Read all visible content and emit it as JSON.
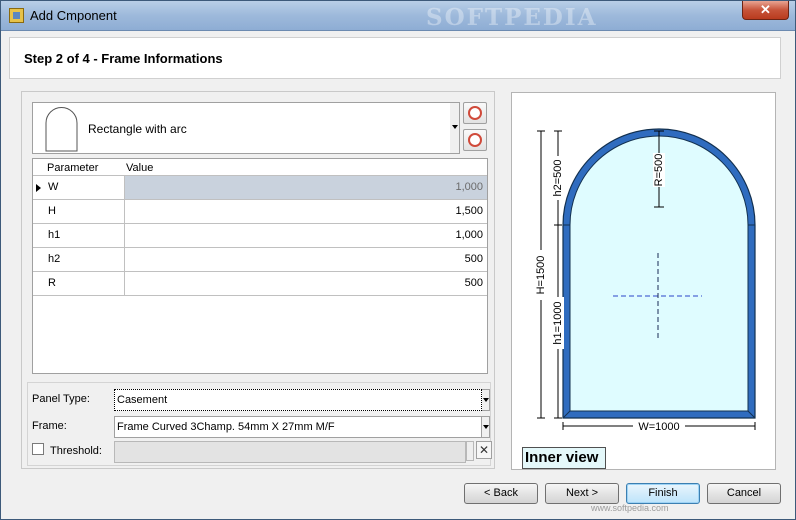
{
  "window": {
    "title": "Add Cmponent",
    "watermark": "SOFTPEDIA",
    "close_label": "✕"
  },
  "header": {
    "title": "Step 2 of 4 - Frame Informations"
  },
  "shape": {
    "selected": "Rectangle with arc",
    "icon": "arc-rectangle-icon"
  },
  "grid": {
    "columns": [
      "Parameter",
      "Value"
    ],
    "rows": [
      {
        "param": "W",
        "value": "1,000"
      },
      {
        "param": "H",
        "value": "1,500"
      },
      {
        "param": "h1",
        "value": "1,000"
      },
      {
        "param": "h2",
        "value": "500"
      },
      {
        "param": "R",
        "value": "500"
      }
    ]
  },
  "props": {
    "panel_type_label": "Panel Type:",
    "panel_type_value": "Casement",
    "frame_label": "Frame:",
    "frame_value": "Frame Curved 3Champ. 54mm X 27mm  M/F",
    "threshold_label": "Threshold:",
    "threshold_value": "",
    "clear_label": "✕"
  },
  "preview": {
    "label": "Inner view",
    "dims": {
      "h2": "h2=500",
      "r": "R=500",
      "H": "H=1500",
      "h1": "h1=1000",
      "W": "W=1000"
    },
    "colors": {
      "frame": "#2f6cbf",
      "frame_edge": "#12304f",
      "glass": "#dffcff",
      "center_cross": "#2b45c9"
    }
  },
  "buttons": {
    "back": "< Back",
    "next": "Next >",
    "finish": "Finish",
    "cancel": "Cancel"
  },
  "footer_watermark": "www.softpedia.com"
}
